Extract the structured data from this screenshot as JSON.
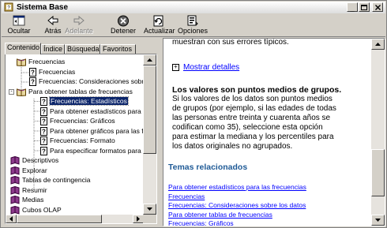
{
  "window": {
    "title": "Sistema Base"
  },
  "toolbar": {
    "hide": "Ocultar",
    "back": "Atrás",
    "forward": "Adelante",
    "stop": "Detener",
    "refresh": "Actualizar",
    "options": "Opciones"
  },
  "tabs": {
    "contents": "Contenido",
    "index": "Índice",
    "search": "Búsqueda",
    "favorites": "Favoritos"
  },
  "tree": {
    "items": [
      "Frecuencias",
      "Frecuencias",
      "Frecuencias: Consideraciones sobre los datos",
      "Para obtener tablas de frecuencias",
      "Frecuencias: Estadísticos",
      "Para obtener estadísticos para las frecuencias",
      "Frecuencias: Gráficos",
      "Para obtener gráficos para las frecuencias",
      "Frecuencias: Formato",
      "Para especificar formatos para las frecuencias",
      "Descriptivos",
      "Explorar",
      "Tablas de contingencia",
      "Resumir",
      "Medias",
      "Cubos OLAP"
    ]
  },
  "content": {
    "top_line": "muestran con sus errores típicos.",
    "show_details": "Mostrar detalles",
    "heading": "Los valores son puntos medios de grupos.",
    "body_lines": [
      "Si los valores de los datos son puntos medios",
      "de grupos (por ejemplo, si las edades de todas",
      "las personas entre treinta y cuarenta años se",
      "codifican como 35), seleccione esta opción",
      "para estimar la mediana y los percentiles para",
      "los datos originales no agrupados."
    ],
    "related_title": "Temas relacionados",
    "related_links": [
      "Para obtener estadísticos para las frecuencias",
      "Frecuencias",
      "Frecuencias: Consideraciones sobre los datos",
      "Para obtener tablas de frecuencias",
      "Frecuencias: Gráficos"
    ]
  },
  "colors": {
    "selection": "#0a246a",
    "link": "#0000ff",
    "related_heading": "#1f5a96"
  }
}
